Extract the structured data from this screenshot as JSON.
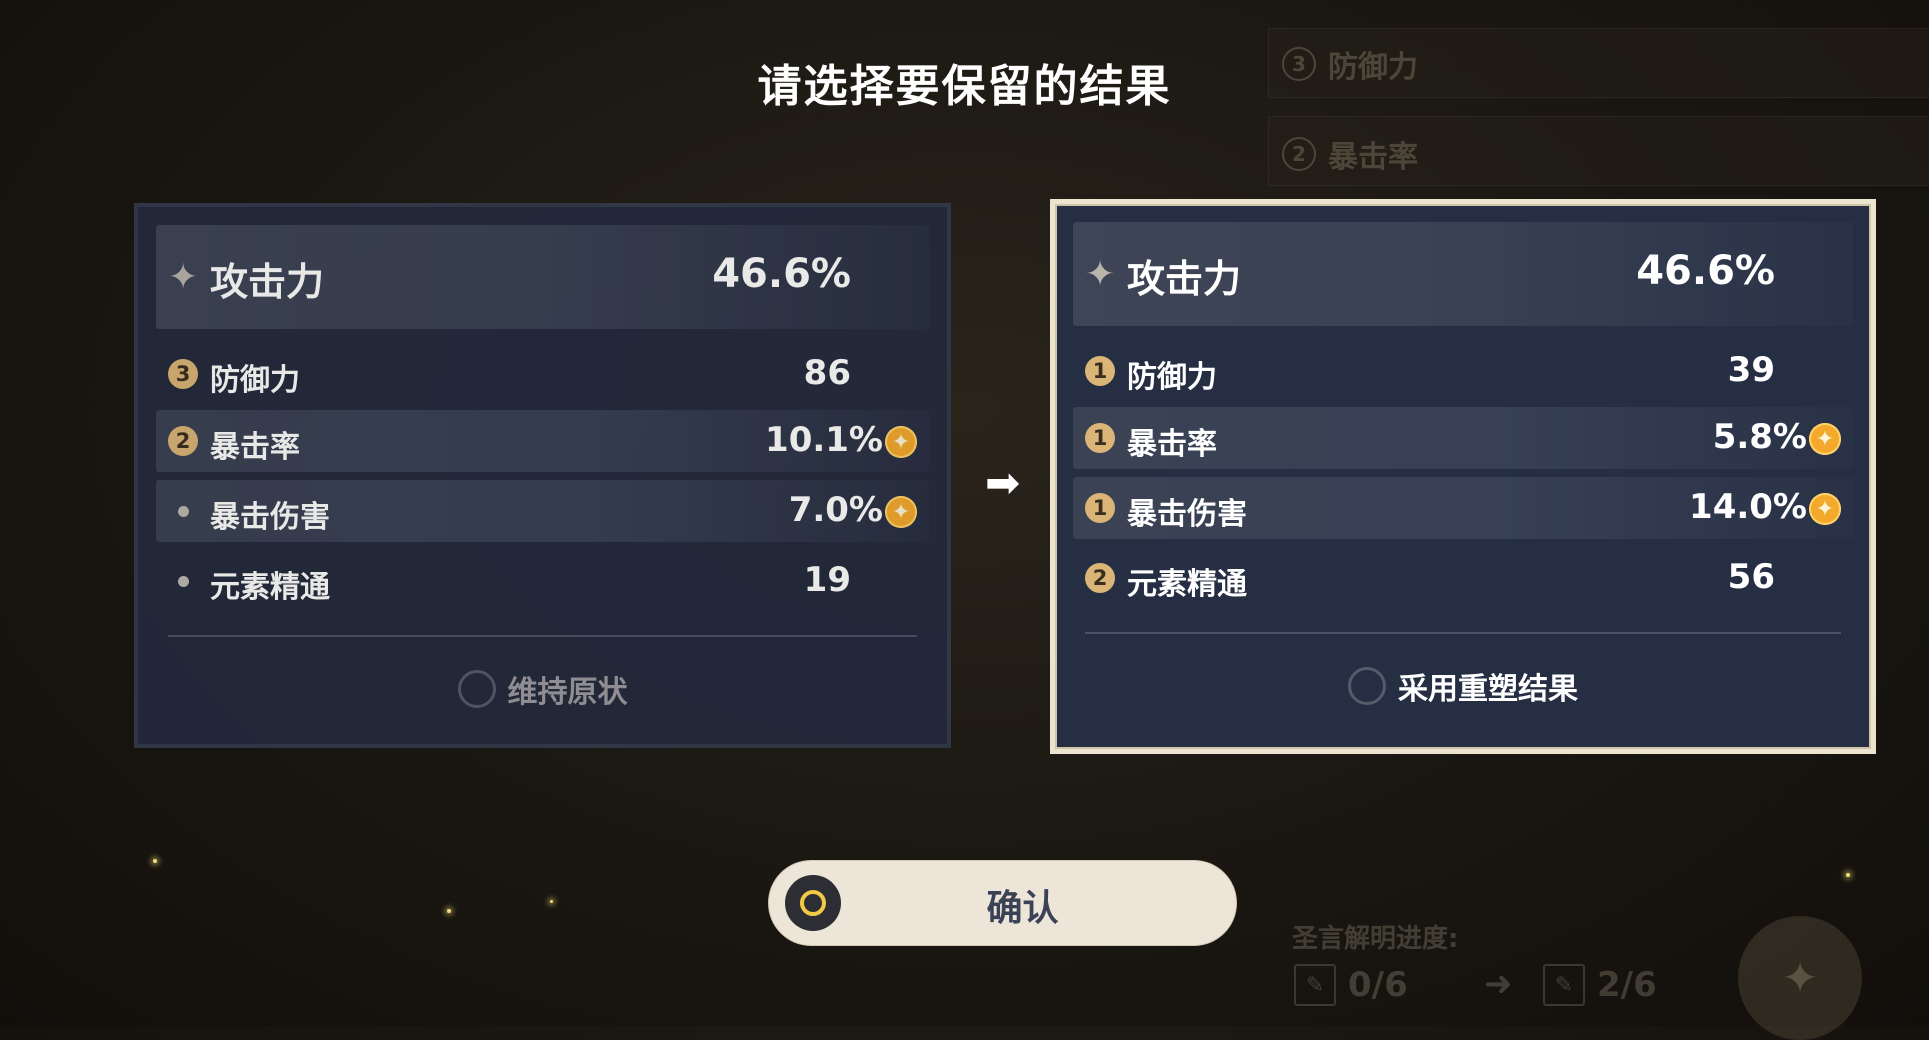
{
  "title": "请选择要保留的结果",
  "background": {
    "rows": [
      {
        "badge": "3",
        "label": "防御力"
      },
      {
        "badge": "2",
        "label": "暴击率"
      }
    ],
    "progress_label": "圣言解明进度:",
    "progress_from": "0/6",
    "progress_to": "2/6"
  },
  "left_card": {
    "main_stat": {
      "name": "攻击力",
      "value": "46.6%"
    },
    "substats": [
      {
        "badge": "3",
        "name": "防御力",
        "value": "86",
        "highlighted": false,
        "star": false
      },
      {
        "badge": "2",
        "name": "暴击率",
        "value": "10.1%",
        "highlighted": true,
        "star": true
      },
      {
        "badge": "",
        "name": "暴击伤害",
        "value": "7.0%",
        "highlighted": true,
        "star": true
      },
      {
        "badge": "",
        "name": "元素精通",
        "value": "19",
        "highlighted": false,
        "star": false
      }
    ],
    "option_label": "维持原状"
  },
  "right_card": {
    "main_stat": {
      "name": "攻击力",
      "value": "46.6%"
    },
    "substats": [
      {
        "badge": "1",
        "name": "防御力",
        "value": "39",
        "highlighted": false,
        "star": false
      },
      {
        "badge": "1",
        "name": "暴击率",
        "value": "5.8%",
        "highlighted": true,
        "star": true
      },
      {
        "badge": "1",
        "name": "暴击伤害",
        "value": "14.0%",
        "highlighted": true,
        "star": true
      },
      {
        "badge": "2",
        "name": "元素精通",
        "value": "56",
        "highlighted": false,
        "star": false
      }
    ],
    "option_label": "采用重塑结果",
    "selected": true
  },
  "confirm_label": "确认",
  "icons": {
    "main_stat": "sparkle-icon",
    "crit_marker": "gold-star-icon",
    "arrow": "arrow-right-icon",
    "confirm": "controller-o-button-icon"
  },
  "colors": {
    "card_bg": "#232a3d",
    "selected_border": "#ede4cf",
    "badge_gold": "#dbb577",
    "crit_gold": "#f2a92c",
    "confirm_bg": "#ece5d8"
  }
}
